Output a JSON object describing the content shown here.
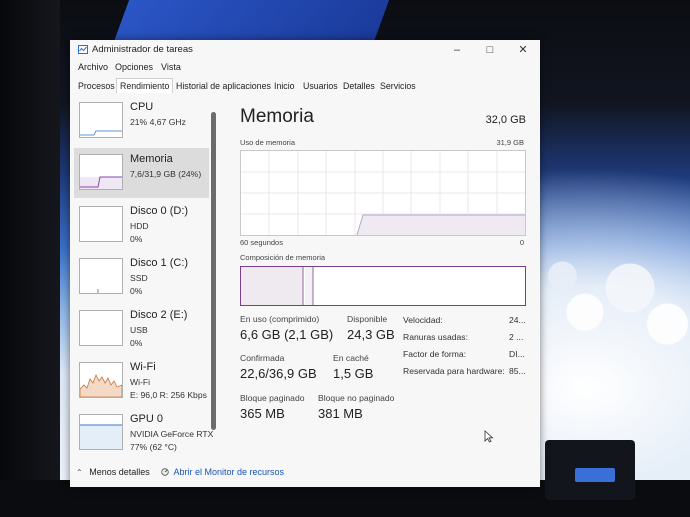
{
  "window": {
    "title": "Administrador de tareas",
    "controls": {
      "minimize": "–",
      "maximize": "□",
      "close": "✕"
    }
  },
  "menu": [
    "Archivo",
    "Opciones",
    "Vista"
  ],
  "tabs": [
    "Procesos",
    "Rendimiento",
    "Historial de aplicaciones",
    "Inicio",
    "Usuarios",
    "Detalles",
    "Servicios"
  ],
  "active_tab": "Rendimiento",
  "sidebar": {
    "items": [
      {
        "name": "CPU",
        "line1": "21%  4,67 GHz",
        "line2": ""
      },
      {
        "name": "Memoria",
        "line1": "7,6/31,9 GB (24%)",
        "line2": ""
      },
      {
        "name": "Disco 0 (D:)",
        "line1": "HDD",
        "line2": "0%"
      },
      {
        "name": "Disco 1 (C:)",
        "line1": "SSD",
        "line2": "0%"
      },
      {
        "name": "Disco 2 (E:)",
        "line1": "USB",
        "line2": "0%"
      },
      {
        "name": "Wi-Fi",
        "line1": "Wi-Fi",
        "line2": "E: 96,0  R: 256 Kbps"
      },
      {
        "name": "GPU 0",
        "line1": "NVIDIA GeForce RTX",
        "line2": "77% (62 °C)"
      }
    ]
  },
  "main": {
    "title": "Memoria",
    "total": "32,0 GB",
    "usage_label": "Uso de memoria",
    "usage_max": "31,9 GB",
    "time_label": "60 segundos",
    "time_min": "0",
    "composition_label": "Composición de memoria",
    "stats": {
      "in_use_label": "En uso (comprimido)",
      "in_use_value": "6,6 GB (2,1 GB)",
      "available_label": "Disponible",
      "available_value": "24,3 GB",
      "committed_label": "Confirmada",
      "committed_value": "22,6/36,9 GB",
      "cached_label": "En caché",
      "cached_value": "1,5 GB",
      "paged_label": "Bloque paginado",
      "paged_value": "365 MB",
      "nonpaged_label": "Bloque no paginado",
      "nonpaged_value": "381 MB"
    },
    "details": [
      {
        "label": "Velocidad:",
        "value": "24..."
      },
      {
        "label": "Ranuras usadas:",
        "value": "2 ..."
      },
      {
        "label": "Factor de forma:",
        "value": "DI..."
      },
      {
        "label": "Reservada para hardware:",
        "value": "85..."
      }
    ]
  },
  "footer": {
    "less_details": "Menos detalles",
    "resource_monitor": "Abrir el Monitor de recursos"
  }
}
